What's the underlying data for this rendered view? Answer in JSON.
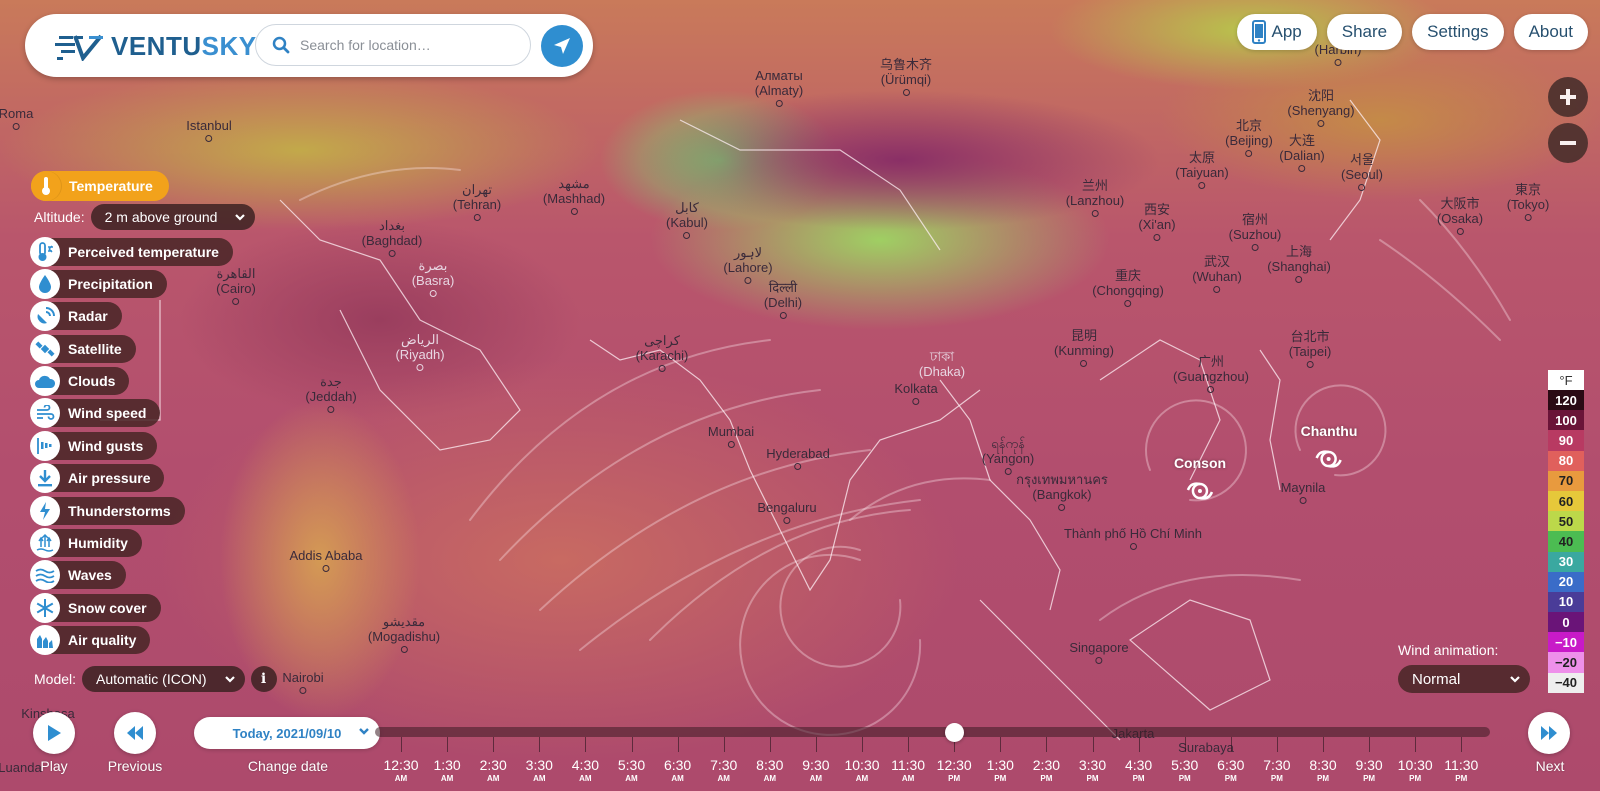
{
  "app": {
    "name_part1": "VENTU",
    "name_part2": "SKY"
  },
  "search": {
    "placeholder": "Search for location…"
  },
  "topnav": {
    "app": "App",
    "share": "Share",
    "settings": "Settings",
    "about": "About"
  },
  "zoom": {
    "in": "+",
    "out": "−"
  },
  "active_layer": {
    "label": "Temperature",
    "icon": "thermometer-icon",
    "color": "#f2a21b"
  },
  "altitude": {
    "label": "Altitude:",
    "value": "2 m above ground"
  },
  "layers": [
    {
      "label": "Perceived temperature",
      "icon": "perceived-temperature-icon"
    },
    {
      "label": "Precipitation",
      "icon": "droplet-icon"
    },
    {
      "label": "Radar",
      "icon": "radar-icon"
    },
    {
      "label": "Satellite",
      "icon": "satellite-icon"
    },
    {
      "label": "Clouds",
      "icon": "cloud-icon"
    },
    {
      "label": "Wind speed",
      "icon": "wind-icon"
    },
    {
      "label": "Wind gusts",
      "icon": "wind-gusts-icon"
    },
    {
      "label": "Air pressure",
      "icon": "air-pressure-icon"
    },
    {
      "label": "Thunderstorms",
      "icon": "lightning-icon"
    },
    {
      "label": "Humidity",
      "icon": "humidity-icon"
    },
    {
      "label": "Waves",
      "icon": "waves-icon"
    },
    {
      "label": "Snow cover",
      "icon": "snowflake-icon"
    },
    {
      "label": "Air quality",
      "icon": "factory-icon"
    }
  ],
  "model": {
    "label": "Model:",
    "value": "Automatic (ICON)",
    "info": "i"
  },
  "playback": {
    "play": "Play",
    "previous": "Previous",
    "change_date": "Change date",
    "next": "Next",
    "date": "Today, 2021/09/10"
  },
  "timeline": {
    "selected_index": 12,
    "ticks": [
      {
        "time": "12:30",
        "ampm": "AM"
      },
      {
        "time": "1:30",
        "ampm": "AM"
      },
      {
        "time": "2:30",
        "ampm": "AM"
      },
      {
        "time": "3:30",
        "ampm": "AM"
      },
      {
        "time": "4:30",
        "ampm": "AM"
      },
      {
        "time": "5:30",
        "ampm": "AM"
      },
      {
        "time": "6:30",
        "ampm": "AM"
      },
      {
        "time": "7:30",
        "ampm": "AM"
      },
      {
        "time": "8:30",
        "ampm": "AM"
      },
      {
        "time": "9:30",
        "ampm": "AM"
      },
      {
        "time": "10:30",
        "ampm": "AM"
      },
      {
        "time": "11:30",
        "ampm": "AM"
      },
      {
        "time": "12:30",
        "ampm": "PM"
      },
      {
        "time": "1:30",
        "ampm": "PM"
      },
      {
        "time": "2:30",
        "ampm": "PM"
      },
      {
        "time": "3:30",
        "ampm": "PM"
      },
      {
        "time": "4:30",
        "ampm": "PM"
      },
      {
        "time": "5:30",
        "ampm": "PM"
      },
      {
        "time": "6:30",
        "ampm": "PM"
      },
      {
        "time": "7:30",
        "ampm": "PM"
      },
      {
        "time": "8:30",
        "ampm": "PM"
      },
      {
        "time": "9:30",
        "ampm": "PM"
      },
      {
        "time": "10:30",
        "ampm": "PM"
      },
      {
        "time": "11:30",
        "ampm": "PM"
      }
    ]
  },
  "legend": {
    "unit": "°F",
    "entries": [
      {
        "value": "120",
        "bg": "#2a0a14",
        "fg": "#ffffff"
      },
      {
        "value": "100",
        "bg": "#6a1438",
        "fg": "#ffffff"
      },
      {
        "value": "90",
        "bg": "#b83a62",
        "fg": "#ffffff"
      },
      {
        "value": "80",
        "bg": "#e0605c",
        "fg": "#ffffff"
      },
      {
        "value": "70",
        "bg": "#e89a3e",
        "fg": "#222222"
      },
      {
        "value": "60",
        "bg": "#e6c83a",
        "fg": "#222222"
      },
      {
        "value": "50",
        "bg": "#bcd84a",
        "fg": "#222222"
      },
      {
        "value": "40",
        "bg": "#4cbc52",
        "fg": "#222222"
      },
      {
        "value": "30",
        "bg": "#3aa8a0",
        "fg": "#ffffff"
      },
      {
        "value": "20",
        "bg": "#3a6cc8",
        "fg": "#ffffff"
      },
      {
        "value": "10",
        "bg": "#4a3c98",
        "fg": "#ffffff"
      },
      {
        "value": "0",
        "bg": "#6a1478",
        "fg": "#ffffff"
      },
      {
        "value": "−10",
        "bg": "#c81ac8",
        "fg": "#ffffff"
      },
      {
        "value": "−20",
        "bg": "#ee90ea",
        "fg": "#222222"
      },
      {
        "value": "−40",
        "bg": "#eeeeee",
        "fg": "#222222"
      }
    ]
  },
  "wind_animation": {
    "label": "Wind animation:",
    "value": "Normal"
  },
  "cities": [
    {
      "name": "Roma"
    },
    {
      "name": "Istanbul"
    },
    {
      "native": "تهران",
      "name": "(Tehran)"
    },
    {
      "native": "مشهد",
      "name": "(Mashhad)"
    },
    {
      "native": "بغداد",
      "name": "(Baghdad)"
    },
    {
      "native": "القاهرة",
      "name": "(Cairo)"
    },
    {
      "native": "بصرة",
      "name": "(Basra)"
    },
    {
      "native": "الرياض",
      "name": "(Riyadh)"
    },
    {
      "native": "جدة",
      "name": "(Jeddah)"
    },
    {
      "native": "کابل",
      "name": "(Kabul)"
    },
    {
      "native": "Алматы",
      "name": "(Almaty)"
    },
    {
      "native": "乌鲁木齐",
      "name": "(Ürümqi)"
    },
    {
      "native": "لاہور",
      "name": "(Lahore)"
    },
    {
      "native": "दिल्ली",
      "name": "(Delhi)"
    },
    {
      "native": "کراچی",
      "name": "(Karachi)"
    },
    {
      "name": "Mumbai"
    },
    {
      "name": "Hyderabad"
    },
    {
      "name": "Bengaluru"
    },
    {
      "native": "ঢাকা",
      "name": "(Dhaka)"
    },
    {
      "name": "Kolkata"
    },
    {
      "native": "ရန်ကုန်",
      "name": "(Yangon)"
    },
    {
      "native": "กรุงเทพมหานคร",
      "name": "(Bangkok)"
    },
    {
      "name": "Thành phố Hồ Chí Minh"
    },
    {
      "name": "Maynila"
    },
    {
      "name": "Singapore"
    },
    {
      "name": "Jakarta"
    },
    {
      "name": "Surabaya"
    },
    {
      "name": "Addis Ababa"
    },
    {
      "native": "مقديشو",
      "name": "(Mogadishu)"
    },
    {
      "name": "Nairobi"
    },
    {
      "name": "Kinshasa"
    },
    {
      "name": "Luanda"
    },
    {
      "native": "兰州",
      "name": "(Lanzhou)"
    },
    {
      "native": "西安",
      "name": "(Xi'an)"
    },
    {
      "native": "重庆",
      "name": "(Chongqing)"
    },
    {
      "native": "昆明",
      "name": "(Kunming)"
    },
    {
      "native": "太原",
      "name": "(Taiyuan)"
    },
    {
      "native": "北京",
      "name": "(Beijing)"
    },
    {
      "native": "宿州",
      "name": "(Suzhou)"
    },
    {
      "native": "武汉",
      "name": "(Wuhan)"
    },
    {
      "native": "上海",
      "name": "(Shanghai)"
    },
    {
      "native": "广州",
      "name": "(Guangzhou)"
    },
    {
      "native": "台北市",
      "name": "(Taipei)"
    },
    {
      "native": "大连",
      "name": "(Dalian)"
    },
    {
      "native": "沈阳",
      "name": "(Shenyang)"
    },
    {
      "native": "서울",
      "name": "(Seoul)"
    },
    {
      "native": "大阪市",
      "name": "(Osaka)"
    },
    {
      "native": "東京",
      "name": "(Tokyo)"
    },
    {
      "name": "(Harbin)"
    }
  ],
  "storms": [
    {
      "name": "Conson"
    },
    {
      "name": "Chanthu"
    }
  ]
}
